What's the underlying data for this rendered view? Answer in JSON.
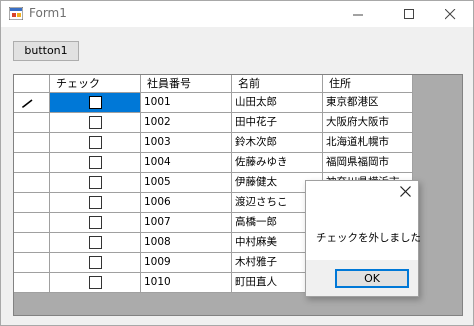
{
  "window": {
    "title": "Form1"
  },
  "toolbar": {
    "button1_label": "button1"
  },
  "grid": {
    "columns": [
      "チェック",
      "社員番号",
      "名前",
      "住所"
    ],
    "rows": [
      {
        "checked": false,
        "id": "1001",
        "name": "山田太郎",
        "address": "東京都港区",
        "editing": true,
        "selected": true
      },
      {
        "checked": false,
        "id": "1002",
        "name": "田中花子",
        "address": "大阪府大阪市"
      },
      {
        "checked": false,
        "id": "1003",
        "name": "鈴木次郎",
        "address": "北海道札幌市"
      },
      {
        "checked": false,
        "id": "1004",
        "name": "佐藤みゆき",
        "address": "福岡県福岡市"
      },
      {
        "checked": false,
        "id": "1005",
        "name": "伊藤健太",
        "address": "神奈川県横浜市"
      },
      {
        "checked": false,
        "id": "1006",
        "name": "渡辺さちこ",
        "address": ""
      },
      {
        "checked": false,
        "id": "1007",
        "name": "高橋一郎",
        "address": ""
      },
      {
        "checked": false,
        "id": "1008",
        "name": "中村麻美",
        "address": ""
      },
      {
        "checked": false,
        "id": "1009",
        "name": "木村雅子",
        "address": ""
      },
      {
        "checked": false,
        "id": "1010",
        "name": "町田直人",
        "address": ""
      }
    ]
  },
  "dialog": {
    "message": "チェックを外しました",
    "ok_label": "OK"
  },
  "colors": {
    "selection": "#0078d7",
    "grid_background": "#ababab"
  }
}
